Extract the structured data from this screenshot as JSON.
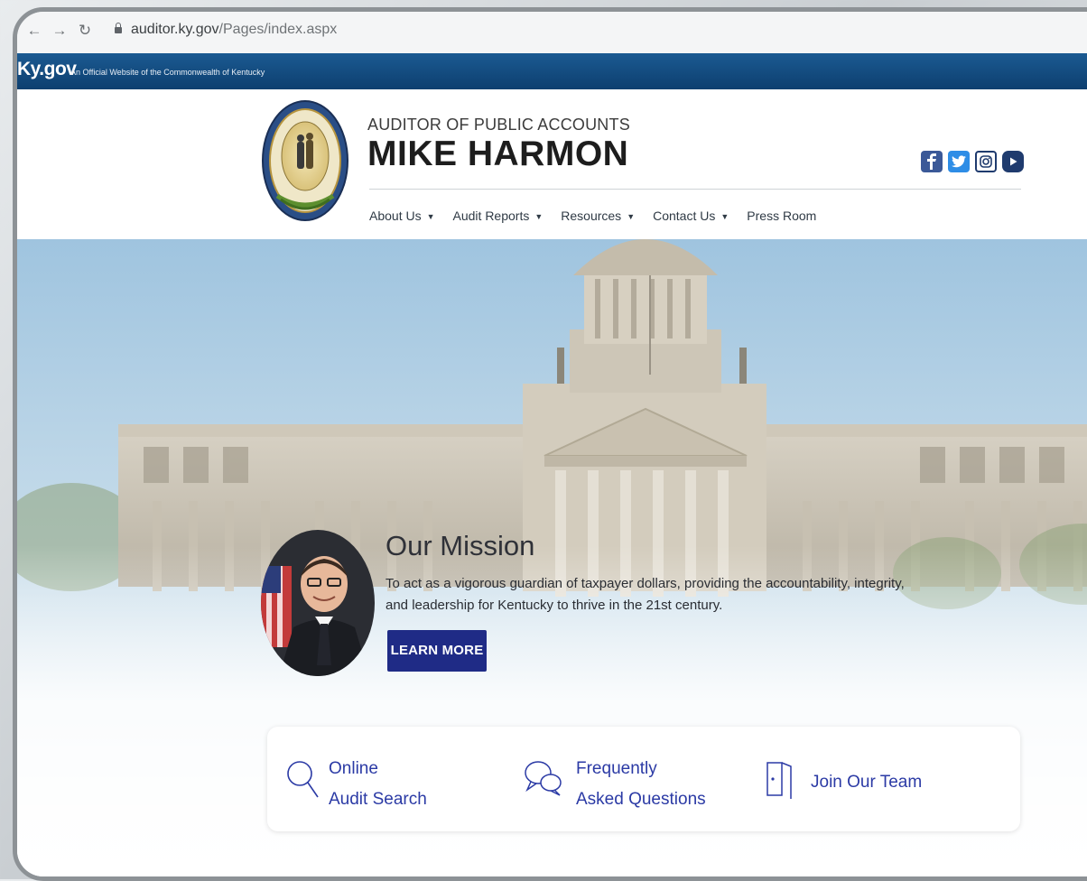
{
  "browser": {
    "url_domain": "auditor.ky.gov",
    "url_path": "/Pages/index.aspx"
  },
  "kybar": {
    "logo": "Ky.gov",
    "tagline": "An Official Website of the Commonwealth of Kentucky"
  },
  "header": {
    "supertitle": "AUDITOR OF PUBLIC ACCOUNTS",
    "title": "MIKE HARMON",
    "social": [
      "facebook-icon",
      "twitter-icon",
      "instagram-icon",
      "youtube-icon"
    ]
  },
  "menu": [
    {
      "label": "About Us",
      "dropdown": true
    },
    {
      "label": "Audit Reports",
      "dropdown": true
    },
    {
      "label": "Resources",
      "dropdown": true
    },
    {
      "label": "Contact Us",
      "dropdown": true
    },
    {
      "label": "Press Room",
      "dropdown": false
    }
  ],
  "mission": {
    "title": "Our Mission",
    "text_line1": "To act as a vigorous guardian of taxpayer dollars, providing the accountability, integrity,",
    "text_line2": "and leadership for Kentucky to thrive in the 21st century.",
    "button": "LEARN MORE"
  },
  "quicklinks": {
    "search_line1": "Online",
    "search_line2": "Audit Search",
    "faq_line1": "Frequently",
    "faq_line2": "Asked Questions",
    "join": "Join Our Team"
  },
  "colors": {
    "kybar": "#0d3f6f",
    "button": "#1f2b86",
    "link": "#2b3aa5"
  }
}
